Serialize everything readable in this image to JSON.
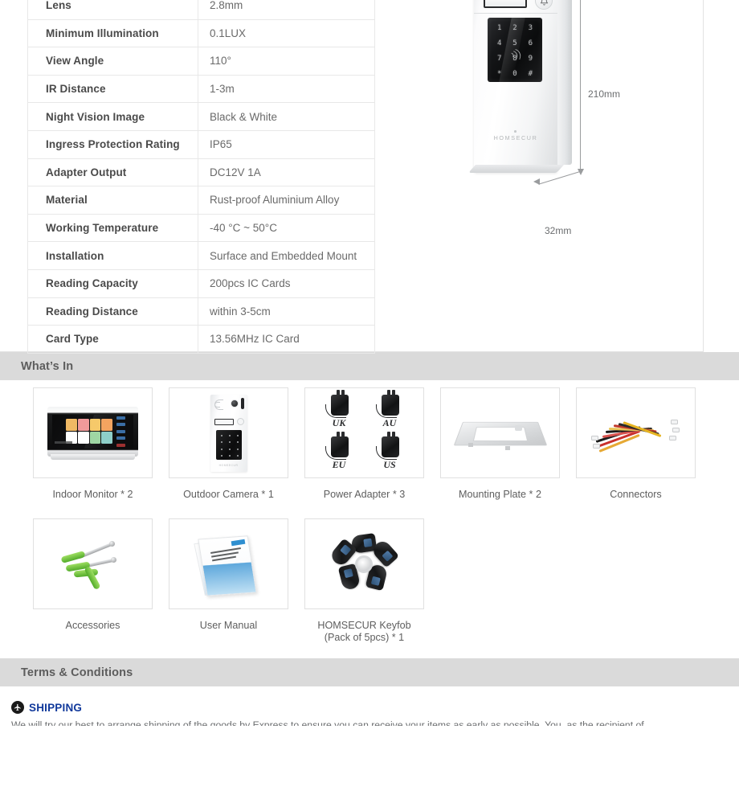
{
  "specs": {
    "rows": [
      {
        "key": "Lens",
        "value": "2.8mm"
      },
      {
        "key": "Minimum Illumination",
        "value": "0.1LUX"
      },
      {
        "key": "View Angle",
        "value": "110°"
      },
      {
        "key": "IR Distance",
        "value": "1-3m"
      },
      {
        "key": "Night Vision Image",
        "value": "Black & White"
      },
      {
        "key": "Ingress Protection Rating",
        "value": "IP65"
      },
      {
        "key": "Adapter Output",
        "value": "DC12V 1A"
      },
      {
        "key": "Material",
        "value": "Rust-proof Aluminium Alloy"
      },
      {
        "key": "Working Temperature",
        "value": "-40 °C ~ 50°C"
      },
      {
        "key": "Installation",
        "value": "Surface and Embedded Mount"
      },
      {
        "key": "Reading Capacity",
        "value": "200pcs IC Cards"
      },
      {
        "key": "Reading Distance",
        "value": "within 3-5cm"
      },
      {
        "key": "Card Type",
        "value": "13.56MHz IC Card"
      }
    ]
  },
  "product_photo": {
    "brand_logo": "HOMSECUR",
    "dimension_height": "210mm",
    "dimension_depth": "32mm",
    "keypad_keys": [
      "1",
      "2",
      "3",
      "4",
      "5",
      "6",
      "7",
      "8",
      "9",
      "*",
      "0",
      "#"
    ]
  },
  "whats_in": {
    "heading": "What’s In",
    "items": [
      {
        "caption": "Indoor Monitor * 2",
        "art": "monitor"
      },
      {
        "caption": "Outdoor Camera * 1",
        "art": "camera"
      },
      {
        "caption": "Power Adapter * 3",
        "art": "adapters"
      },
      {
        "caption": "Mounting Plate * 2",
        "art": "plate"
      },
      {
        "caption": "Connectors",
        "art": "connectors"
      },
      {
        "caption": "Accessories",
        "art": "accessories"
      },
      {
        "caption": "User Manual",
        "art": "manual"
      },
      {
        "caption": "HOMSECUR Keyfob\n(Pack of 5pcs) * 1",
        "art": "keyfobs"
      }
    ],
    "adapter_labels": [
      "UK",
      "AU",
      "EU",
      "US"
    ]
  },
  "terms": {
    "heading": "Terms & Conditions",
    "shipping_label": "SHIPPING",
    "shipping_paragraph": "We will try our best to arrange shipping of the goods by Express to ensure you can receive your items as early as possible. You, as the recipient of"
  },
  "colors": {
    "section_bar_bg": "#dadada",
    "section_bar_text": "#5d5d5d",
    "shipping_accent": "#11399b",
    "table_border": "#e8e8e8",
    "key_text": "#4a4a4a",
    "value_text": "#6a6a6a"
  }
}
